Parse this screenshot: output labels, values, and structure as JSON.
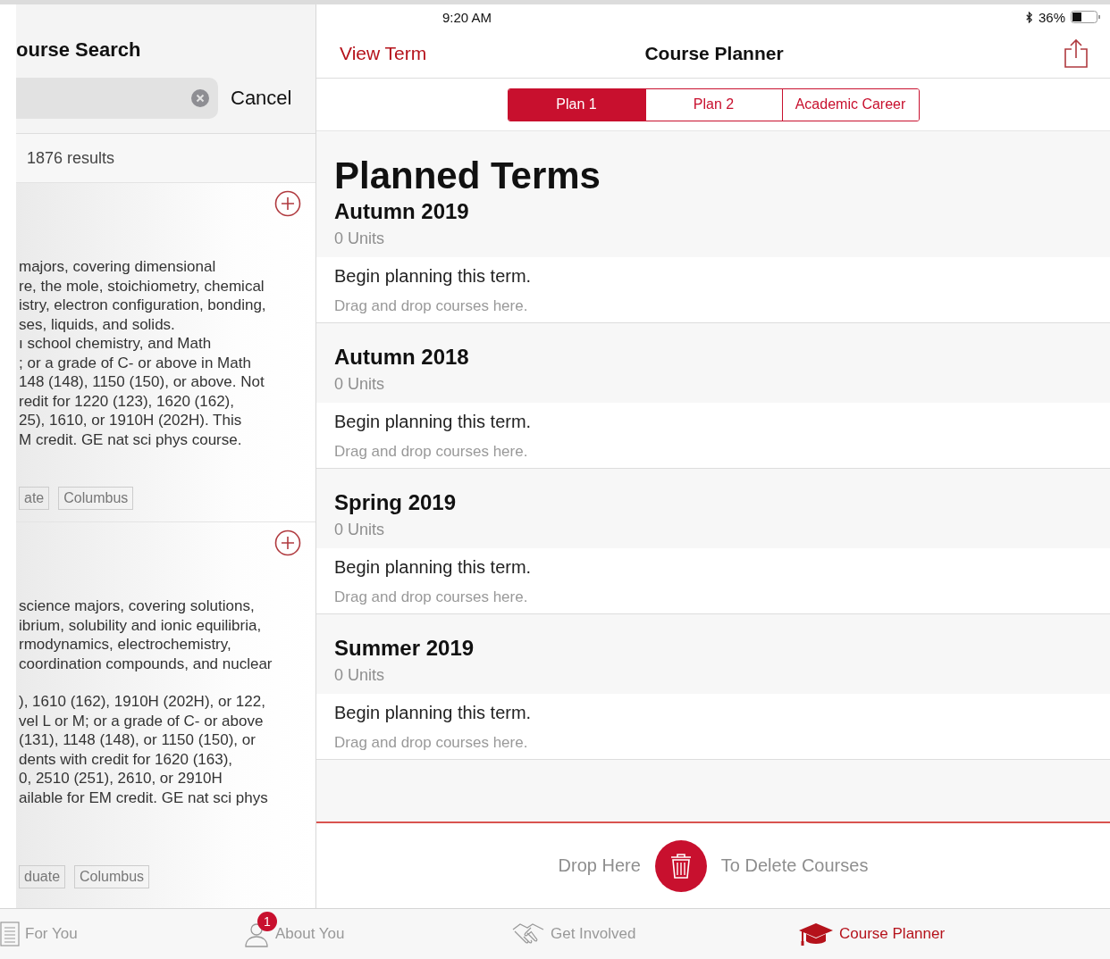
{
  "status_bar": {
    "time": "9:20 AM",
    "battery": "36%"
  },
  "search_panel": {
    "title": "ourse Search",
    "cancel": "Cancel",
    "results": "1876 results",
    "courses": [
      {
        "paragraphs": [
          [
            "majors, covering dimensional",
            "re, the mole, stoichiometry, chemical",
            "istry, electron configuration, bonding,",
            "ses, liquids, and solids.",
            "ı school chemistry, and Math",
            "; or a grade of C- or above in Math",
            "148 (148), 1150 (150), or above. Not",
            "redit for 1220 (123), 1620 (162),",
            "25), 1610, or 1910H (202H). This",
            "M credit. GE nat sci phys course."
          ]
        ],
        "tags": [
          "ate",
          "Columbus"
        ]
      },
      {
        "paragraphs": [
          [
            "science majors, covering solutions,",
            "ibrium, solubility and ionic equilibria,",
            "rmodynamics, electrochemistry,",
            "coordination compounds, and nuclear"
          ],
          [
            "), 1610 (162), 1910H (202H), or 122,",
            "vel L or M; or a grade of C- or above",
            "(131), 1148 (148), or 1150 (150), or",
            "dents with credit for 1620 (163),",
            "0, 2510 (251), 2610, or 2910H",
            "ailable for EM credit. GE nat sci phys"
          ]
        ],
        "tags": [
          "duate",
          "Columbus"
        ]
      }
    ]
  },
  "nav_bar": {
    "back": "View Term",
    "title": "Course Planner"
  },
  "segments": [
    {
      "label": "Plan 1",
      "selected": true
    },
    {
      "label": "Plan 2",
      "selected": false
    },
    {
      "label": "Academic Career",
      "selected": false
    }
  ],
  "heading": "Planned Terms",
  "terms": [
    {
      "name": "Autumn 2019",
      "units": "0 Units",
      "prompt": "Begin planning this term.",
      "hint": "Drag and drop courses here."
    },
    {
      "name": "Autumn 2018",
      "units": "0 Units",
      "prompt": "Begin planning this term.",
      "hint": "Drag and drop courses here."
    },
    {
      "name": "Spring 2019",
      "units": "0 Units",
      "prompt": "Begin planning this term.",
      "hint": "Drag and drop courses here."
    },
    {
      "name": "Summer 2019",
      "units": "0 Units",
      "prompt": "Begin planning this term.",
      "hint": "Drag and drop courses here."
    }
  ],
  "delete_zone": {
    "left": "Drop Here",
    "right": "To Delete Courses"
  },
  "tab_bar": [
    {
      "label": "For You",
      "selected": false
    },
    {
      "label": "About You",
      "badge": "1",
      "selected": false
    },
    {
      "label": "Get Involved",
      "selected": false
    },
    {
      "label": "Course Planner",
      "selected": true
    }
  ]
}
